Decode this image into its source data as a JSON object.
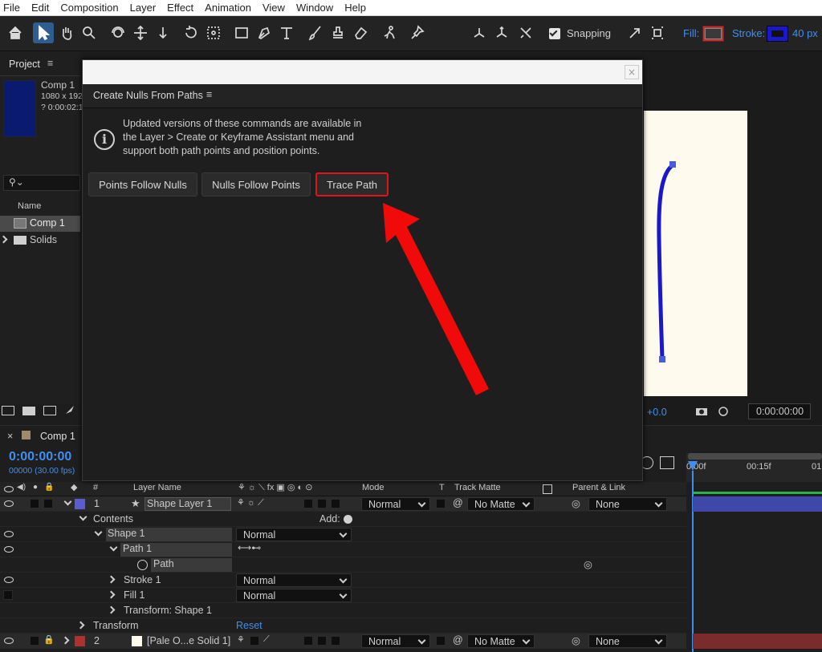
{
  "menu": [
    "File",
    "Edit",
    "Composition",
    "Layer",
    "Effect",
    "Animation",
    "View",
    "Window",
    "Help"
  ],
  "toolbar": {
    "snapping_label": "Snapping",
    "fill_label": "Fill:",
    "stroke_label": "Stroke:",
    "stroke_width": "40 px",
    "fill_color": "#c43030",
    "stroke_color": "#1a18c8",
    "accent": "#2f7ad6"
  },
  "project": {
    "tab": "Project",
    "comp_name": "Comp 1",
    "comp_dims": "1080 x 192",
    "comp_duration": "? 0:00:02:1",
    "column_name": "Name",
    "items": [
      "Comp 1",
      "Solids"
    ]
  },
  "viewer": {
    "offset": "+0.0",
    "timecode": "0:00:00:00"
  },
  "dialog": {
    "title": "Create Nulls From Paths",
    "info": [
      "Updated versions of these commands are available in",
      "the Layer > Create or Keyframe Assistant menu and",
      "support both path points and position points."
    ],
    "buttons": [
      "Points Follow Nulls",
      "Nulls Follow Points",
      "Trace Path"
    ],
    "highlighted_button": "Trace Path",
    "highlight_color": "#e0141b"
  },
  "timeline": {
    "tab": "Comp 1",
    "timecode": "0:00:00:00",
    "frames": "00000 (30.00 fps)",
    "ruler": [
      "0:00f",
      "00:15f",
      "01"
    ],
    "columns": {
      "hash": "#",
      "layer_name": "Layer Name",
      "mode": "Mode",
      "t": "T",
      "track_matte": "Track Matte",
      "parent": "Parent & Link"
    },
    "layer1": {
      "num": "1",
      "name": "Shape Layer 1",
      "mode": "Normal",
      "matte": "No Matte",
      "parent": "None",
      "label_color": "#5a5ccf"
    },
    "contents": "Contents",
    "add": "Add:",
    "shape1": {
      "name": "Shape 1",
      "mode": "Normal"
    },
    "path1": "Path 1",
    "path": "Path",
    "stroke1": {
      "name": "Stroke 1",
      "mode": "Normal"
    },
    "fill1": {
      "name": "Fill 1",
      "mode": "Normal"
    },
    "transform_shape": "Transform: Shape 1",
    "transform": "Transform",
    "reset": "Reset",
    "layer2": {
      "num": "2",
      "name": "[Pale O...e Solid 1]",
      "mode": "Normal",
      "matte": "No Matte",
      "parent": "None",
      "label_color": "#b03030"
    }
  }
}
